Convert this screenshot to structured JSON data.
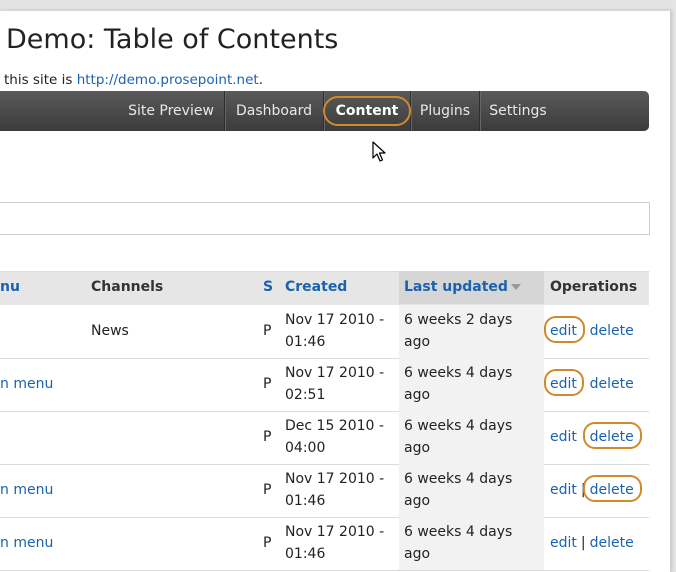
{
  "site": {
    "title": "Demo: Table of Contents",
    "subtitle_prefix": "this site is ",
    "subtitle_link": "http://demo.prosepoint.net",
    "subtitle_suffix": "."
  },
  "nav": {
    "items": [
      "Site Preview",
      "Dashboard",
      "Content",
      "Plugins",
      "Settings"
    ],
    "active": "Content"
  },
  "table": {
    "headers": {
      "menu": "nu",
      "channels": "Channels",
      "status": "S",
      "created": "Created",
      "updated": "Last updated",
      "operations": "Operations"
    },
    "rows": [
      {
        "menu": "",
        "channels": "News",
        "status": "P",
        "created_1": "Nov 17 2010 -",
        "created_2": "01:46",
        "updated_1": "6 weeks 2 days",
        "updated_2": "ago"
      },
      {
        "menu": "n menu",
        "channels": "",
        "status": "P",
        "created_1": "Nov 17 2010 -",
        "created_2": "02:51",
        "updated_1": "6 weeks 4 days",
        "updated_2": "ago"
      },
      {
        "menu": "",
        "channels": "",
        "status": "P",
        "created_1": "Dec 15 2010 -",
        "created_2": "04:00",
        "updated_1": "6 weeks 4 days",
        "updated_2": "ago"
      },
      {
        "menu": "n menu",
        "channels": "",
        "status": "P",
        "created_1": "Nov 17 2010 -",
        "created_2": "01:46",
        "updated_1": "6 weeks 4 days",
        "updated_2": "ago"
      },
      {
        "menu": "n menu",
        "channels": "",
        "status": "P",
        "created_1": "Nov 17 2010 -",
        "created_2": "01:46",
        "updated_1": "6 weeks 4 days",
        "updated_2": "ago"
      }
    ],
    "edit_label": "edit",
    "delete_label": "delete",
    "ops_separator": "|"
  },
  "colors": {
    "link": "#1a62b0",
    "highlight": "#d08a2a",
    "navbar": "#3b3b3b"
  },
  "icons": {
    "cursor": "mouse-pointer-icon",
    "sort": "sort-descending-icon"
  }
}
